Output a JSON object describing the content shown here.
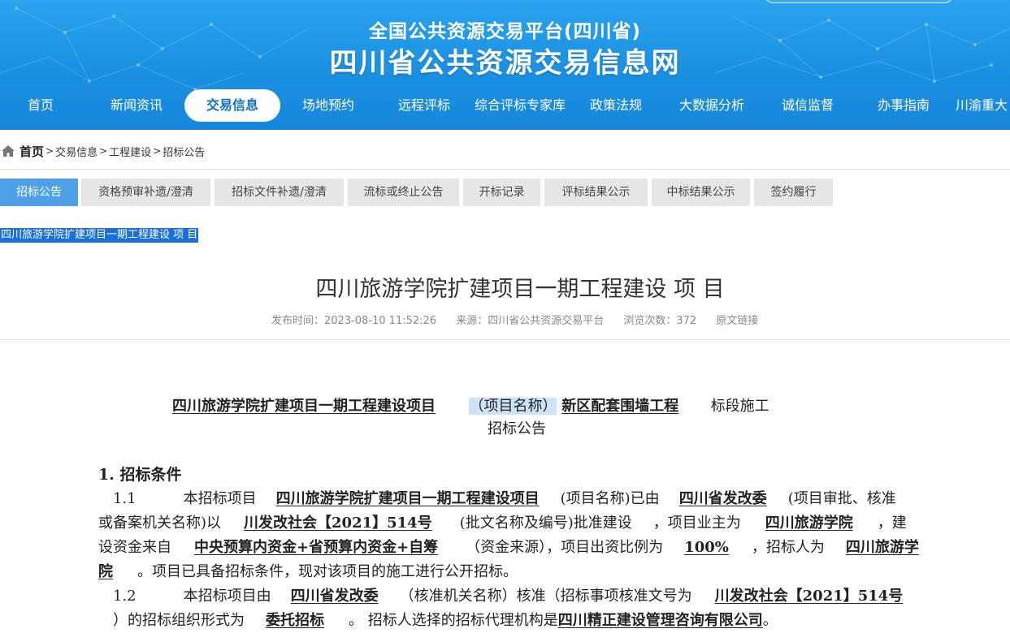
{
  "header": {
    "subtitle": "全国公共资源交易平台(四川省)",
    "title": "四川省公共资源交易信息网",
    "nav": [
      {
        "label": "首页"
      },
      {
        "label": "新闻资讯"
      },
      {
        "label": "交易信息",
        "active": true
      },
      {
        "label": "场地预约"
      },
      {
        "label": "远程评标"
      },
      {
        "label": "综合评标专家库"
      },
      {
        "label": "政策法规"
      },
      {
        "label": "大数据分析"
      },
      {
        "label": "诚信监督"
      },
      {
        "label": "办事指南"
      },
      {
        "label": "川渝重大"
      }
    ]
  },
  "breadcrumb": {
    "home": "首页",
    "sep": ">",
    "items": [
      "交易信息",
      "工程建设",
      "招标公告"
    ]
  },
  "tabs": [
    {
      "label": "招标公告",
      "active": true
    },
    {
      "label": "资格预审补遗/澄清"
    },
    {
      "label": "招标文件补遗/澄清"
    },
    {
      "label": "流标或终止公告"
    },
    {
      "label": "开标记录"
    },
    {
      "label": "评标结果公示"
    },
    {
      "label": "中标结果公示"
    },
    {
      "label": "签约履行"
    }
  ],
  "selected_title": "四川旅游学院扩建项目一期工程建设 项 目",
  "article": {
    "title": "四川旅游学院扩建项目一期工程建设 项 目",
    "publish_time": "发布时间：2023-08-10 11:52:26",
    "source": "来源：四川省公共资源交易平台",
    "views": "浏览次数：372",
    "original_link": "原文链接"
  },
  "doc": {
    "heading_project": "四川旅游学院扩建项目一期工程建设项目",
    "heading_label": "（项目名称）",
    "heading_section": "新区配套围墙工程",
    "heading_suffix": "标段施工",
    "heading_line2": "招标公告",
    "section1": "1.  招标条件",
    "p1_num": "1.1",
    "p1_a": "本招标项目",
    "p1_project": "四川旅游学院扩建项目一期工程建设项目",
    "p1_b": "(项目名称)已由",
    "p1_approver": "四川省发改委",
    "p1_c": "(项目审批、核准",
    "p1_d": "或备案机关名称)以",
    "p1_docno": "川发改社会【2021】514号",
    "p1_e": "(批文名称及编号)批准建设",
    "p1_f": "，项目业主为",
    "p1_owner": "四川旅游学院",
    "p1_g": "，建",
    "p1_h": "设资金来自",
    "p1_funds": "中央预算内资金+省预算内资金+自筹",
    "p1_i": "（资金来源），项目出资比例为",
    "p1_ratio": "100%",
    "p1_j": "，招标人为",
    "p1_tenderer_a": "四川旅游学",
    "p1_tenderer_b": "院",
    "p1_k": "。项目已具备招标条件，现对该项目的施工进行公开招标。",
    "p2_num": "1.2",
    "p2_a": "本招标项目由",
    "p2_approver": "四川省发改委",
    "p2_b": "（核准机关名称）核准（招标事项核准文号为",
    "p2_docno": "川发改社会【2021】514号",
    "p2_c": "）的招标组织形式为",
    "p2_form": "委托招标",
    "p2_d": "。 招标人选择的招标代理机构是",
    "p2_agency": "四川精正建设管理咨询有限公司",
    "p2_e": "。"
  }
}
